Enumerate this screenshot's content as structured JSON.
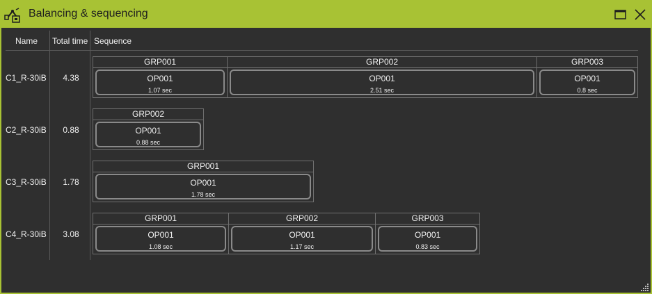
{
  "window": {
    "title": "Balancing & sequencing"
  },
  "header": {
    "name": "Name",
    "total_time": "Total time",
    "sequence": "Sequence"
  },
  "rows": [
    {
      "name": "C1_R-30iB",
      "total": "4.38",
      "groups": [
        {
          "label": "GRP001",
          "op": "OP001",
          "time": "1.07 sec"
        },
        {
          "label": "GRP002",
          "op": "OP001",
          "time": "2.51 sec"
        },
        {
          "label": "GRP003",
          "op": "OP001",
          "time": "0.8 sec"
        }
      ]
    },
    {
      "name": "C2_R-30iB",
      "total": "0.88",
      "groups": [
        {
          "label": "GRP002",
          "op": "OP001",
          "time": "0.88 sec"
        }
      ]
    },
    {
      "name": "C3_R-30iB",
      "total": "1.78",
      "groups": [
        {
          "label": "GRP001",
          "op": "OP001",
          "time": "1.78 sec"
        }
      ]
    },
    {
      "name": "C4_R-30iB",
      "total": "3.08",
      "groups": [
        {
          "label": "GRP001",
          "op": "OP001",
          "time": "1.08 sec"
        },
        {
          "label": "GRP002",
          "op": "OP001",
          "time": "1.17 sec"
        },
        {
          "label": "GRP003",
          "op": "OP001",
          "time": "0.83 sec"
        }
      ]
    }
  ],
  "icons": {
    "app": "robot-arm-icon",
    "maximize": "maximize-icon",
    "close": "close-icon",
    "resize": "resize-grip-icon"
  },
  "colors": {
    "accent": "#a8c234",
    "background": "#2f2f2f",
    "border": "#707070",
    "text": "#f0f0f0"
  }
}
